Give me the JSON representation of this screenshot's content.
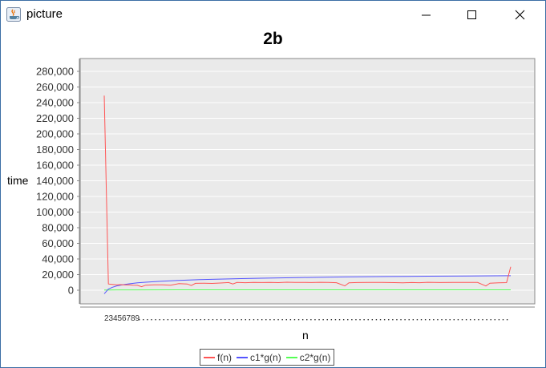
{
  "window": {
    "title": "picture",
    "icon": "java-icon",
    "controls": {
      "minimize": "minimize-icon",
      "maximize": "maximize-icon",
      "close": "close-icon"
    }
  },
  "chart_data": {
    "type": "line",
    "title": "2b",
    "xlabel": "n",
    "ylabel": "time",
    "ylim": [
      0,
      280000
    ],
    "yticks": [
      "0",
      "20,000",
      "40,000",
      "60,000",
      "80,000",
      "100,000",
      "120,000",
      "140,000",
      "160,000",
      "180,000",
      "200,000",
      "220,000",
      "240,000",
      "260,000",
      "280,000"
    ],
    "xticks_visible": [
      "2",
      "3",
      "4",
      "5",
      "6",
      "7",
      "8",
      "9"
    ],
    "x_first": 2,
    "x_last": 100,
    "grid": true,
    "legend": "bottom",
    "series": [
      {
        "name": "f(n)",
        "color": "#ff5555",
        "points": [
          [
            2,
            249000
          ],
          [
            3,
            8000
          ],
          [
            4,
            7500
          ],
          [
            5,
            7000
          ],
          [
            6,
            7200
          ],
          [
            7,
            6800
          ],
          [
            8,
            7000
          ],
          [
            9,
            6500
          ],
          [
            10,
            6300
          ],
          [
            11,
            4500
          ],
          [
            12,
            6500
          ],
          [
            14,
            7000
          ],
          [
            16,
            6900
          ],
          [
            18,
            6500
          ],
          [
            20,
            8500
          ],
          [
            22,
            8000
          ],
          [
            23,
            6000
          ],
          [
            24,
            8800
          ],
          [
            26,
            9000
          ],
          [
            28,
            8700
          ],
          [
            30,
            9200
          ],
          [
            32,
            9800
          ],
          [
            33,
            8000
          ],
          [
            34,
            9900
          ],
          [
            36,
            9600
          ],
          [
            38,
            10000
          ],
          [
            40,
            9800
          ],
          [
            42,
            10100
          ],
          [
            44,
            9700
          ],
          [
            46,
            10300
          ],
          [
            48,
            9900
          ],
          [
            50,
            10100
          ],
          [
            52,
            9800
          ],
          [
            54,
            10200
          ],
          [
            56,
            10000
          ],
          [
            58,
            9600
          ],
          [
            60,
            5500
          ],
          [
            61,
            9500
          ],
          [
            63,
            9800
          ],
          [
            66,
            10000
          ],
          [
            69,
            9900
          ],
          [
            72,
            9700
          ],
          [
            74,
            9400
          ],
          [
            76,
            9800
          ],
          [
            78,
            9600
          ],
          [
            80,
            10200
          ],
          [
            83,
            9800
          ],
          [
            86,
            10000
          ],
          [
            89,
            10100
          ],
          [
            92,
            9900
          ],
          [
            94,
            5400
          ],
          [
            95,
            9000
          ],
          [
            97,
            9500
          ],
          [
            99,
            9700
          ],
          [
            100,
            30000
          ]
        ]
      },
      {
        "name": "c1*g(n)",
        "color": "#5555ff",
        "points": [
          [
            2,
            -4500
          ],
          [
            3,
            1500
          ],
          [
            4,
            3800
          ],
          [
            5,
            5500
          ],
          [
            6,
            6600
          ],
          [
            7,
            7500
          ],
          [
            8,
            8200
          ],
          [
            10,
            9400
          ],
          [
            12,
            10300
          ],
          [
            15,
            11300
          ],
          [
            20,
            12600
          ],
          [
            25,
            13500
          ],
          [
            30,
            14300
          ],
          [
            35,
            14900
          ],
          [
            40,
            15400
          ],
          [
            50,
            16300
          ],
          [
            60,
            17000
          ],
          [
            70,
            17500
          ],
          [
            80,
            17900
          ],
          [
            90,
            18300
          ],
          [
            100,
            18600
          ]
        ]
      },
      {
        "name": "c2*g(n)",
        "color": "#55ff55",
        "points": [
          [
            2,
            200
          ],
          [
            3,
            300
          ],
          [
            5,
            400
          ],
          [
            10,
            450
          ],
          [
            20,
            500
          ],
          [
            40,
            500
          ],
          [
            60,
            500
          ],
          [
            80,
            500
          ],
          [
            100,
            500
          ]
        ]
      }
    ]
  }
}
